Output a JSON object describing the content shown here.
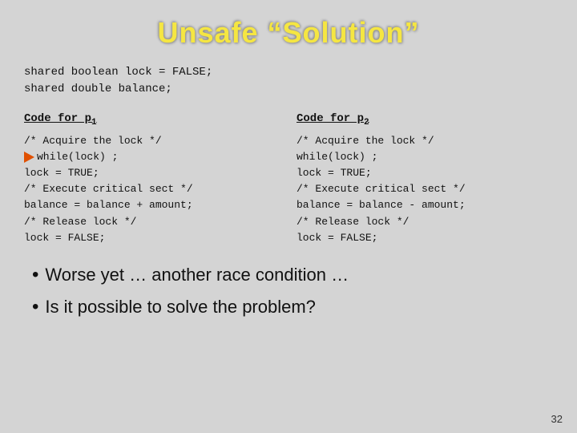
{
  "slide": {
    "title": "Unsafe “Solution”",
    "shared_vars": {
      "line1": "shared boolean lock = FALSE;",
      "line2": "shared double balance;"
    },
    "code_p1": {
      "header": "Code for p",
      "header_sub": "1",
      "lines": [
        "/* Acquire the lock */",
        "  while(lock) ;",
        "  lock = TRUE;",
        "/* Execute critical sect */",
        "  balance = balance + amount;",
        "/* Release lock */",
        "  lock = FALSE;"
      ],
      "arrow_line": 1
    },
    "code_p2": {
      "header": "Code for p",
      "header_sub": "2",
      "lines": [
        "/* Acquire the lock */",
        "  while(lock) ;",
        "  lock = TRUE;",
        "/* Execute critical sect */",
        "  balance = balance - amount;",
        "/* Release lock */",
        "  lock = FALSE;"
      ]
    },
    "bullets": [
      "Worse yet … another race condition …",
      "Is it possible to solve the problem?"
    ],
    "page_number": "32"
  }
}
